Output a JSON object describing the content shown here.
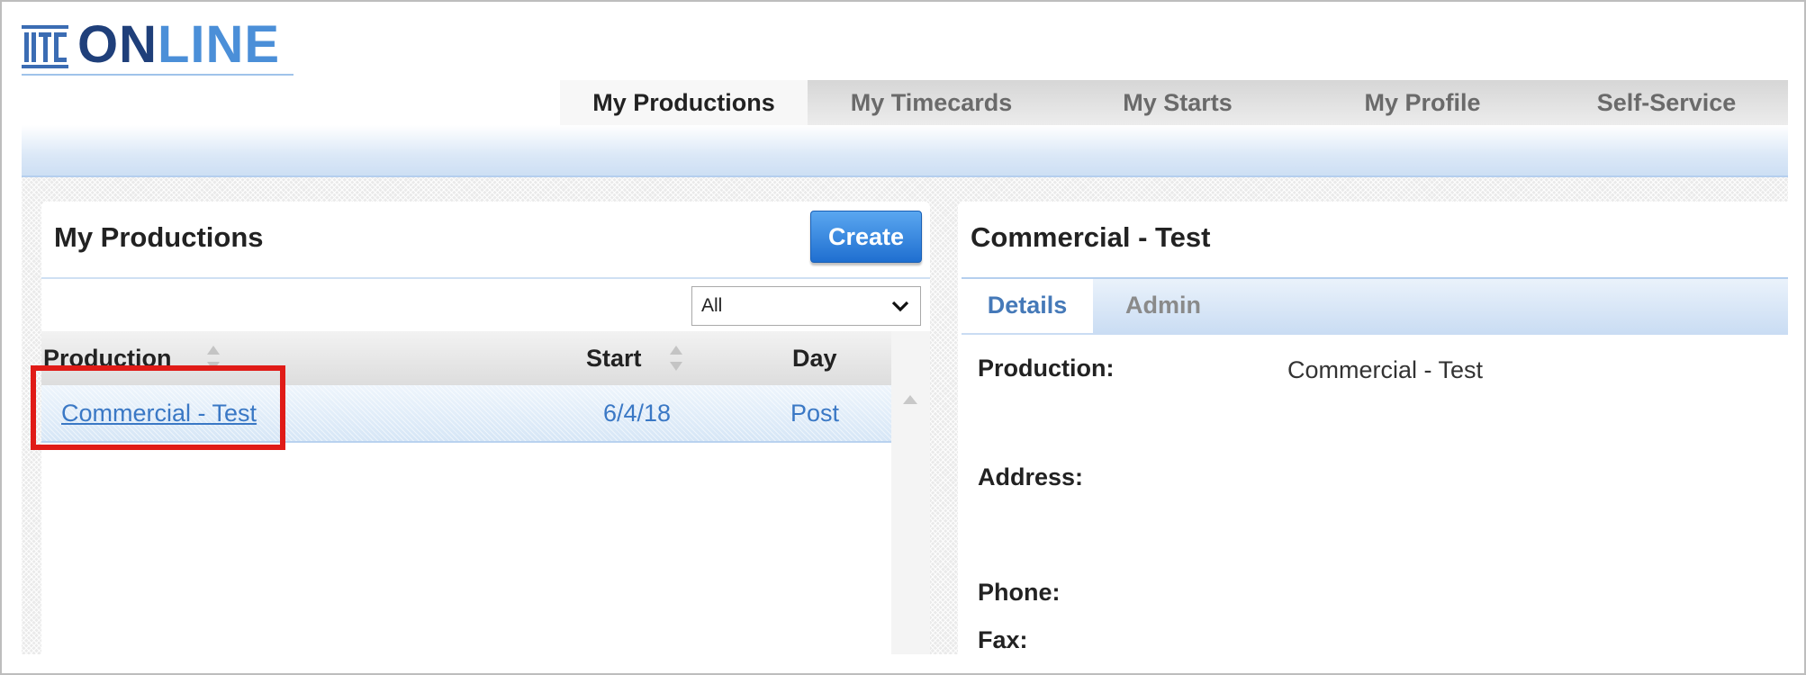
{
  "brand": {
    "mark_text": "TC",
    "name_part1": "ON",
    "name_part2": "LINE"
  },
  "nav": {
    "tabs": [
      {
        "label": "My Productions",
        "active": true
      },
      {
        "label": "My Timecards",
        "active": false
      },
      {
        "label": "My Starts",
        "active": false
      },
      {
        "label": "My Profile",
        "active": false
      },
      {
        "label": "Self-Service",
        "active": false
      }
    ]
  },
  "productions_panel": {
    "title": "My Productions",
    "create_label": "Create",
    "filter": {
      "selected": "All"
    },
    "columns": {
      "production": "Production",
      "start": "Start",
      "day": "Day"
    },
    "rows": [
      {
        "production": "Commercial - Test",
        "start": "6/4/18",
        "day": "Post"
      }
    ]
  },
  "details_panel": {
    "title": "Commercial - Test",
    "tabs": [
      {
        "label": "Details",
        "active": true
      },
      {
        "label": "Admin",
        "active": false
      }
    ],
    "fields": {
      "production_label": "Production:",
      "production_value": "Commercial - Test",
      "address_label": "Address:",
      "phone_label": "Phone:",
      "fax_label": "Fax:"
    }
  },
  "colors": {
    "brand_dark": "#1f3f7a",
    "brand_light": "#4b8fd8",
    "link": "#3a78c5",
    "highlight": "#e01b17",
    "button": "#2a7fe0"
  }
}
